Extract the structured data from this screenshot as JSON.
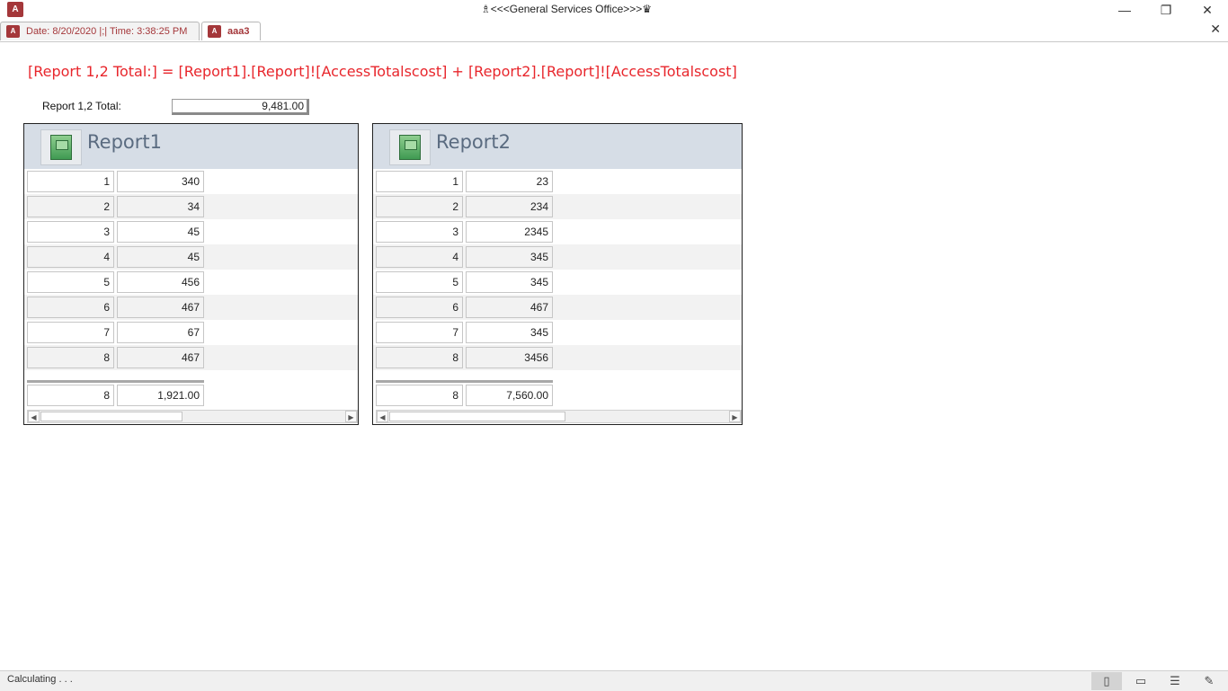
{
  "window": {
    "title": "♗<<<General Services Office>>>♛",
    "app_icon": "A",
    "minimize": "—",
    "restore": "❐",
    "close": "✕"
  },
  "tabs": [
    {
      "label": "Date: 8/20/2020 |;| Time: 3:38:25 PM",
      "icon": "access-icon",
      "active": false
    },
    {
      "label": "aaa3",
      "icon": "access-icon",
      "active": true
    }
  ],
  "tab_close": "✕",
  "form": {
    "formula": "[Report 1,2 Total:] = [Report1].[Report]![AccessTotalscost] + [Report2].[Report]![AccessTotalscost]",
    "total_label": "Report 1,2 Total:",
    "total_value": "9,481.00"
  },
  "report1": {
    "title": "Report1",
    "rows": [
      [
        "1",
        "340"
      ],
      [
        "2",
        "34"
      ],
      [
        "3",
        "45"
      ],
      [
        "4",
        "45"
      ],
      [
        "5",
        "456"
      ],
      [
        "6",
        "467"
      ],
      [
        "7",
        "67"
      ],
      [
        "8",
        "467"
      ]
    ],
    "footer": [
      "8",
      "1,921.00"
    ]
  },
  "report2": {
    "title": "Report2",
    "rows": [
      [
        "1",
        "23"
      ],
      [
        "2",
        "234"
      ],
      [
        "3",
        "2345"
      ],
      [
        "4",
        "345"
      ],
      [
        "5",
        "345"
      ],
      [
        "6",
        "467"
      ],
      [
        "7",
        "345"
      ],
      [
        "8",
        "3456"
      ]
    ],
    "footer": [
      "8",
      "7,560.00"
    ]
  },
  "statusbar": {
    "text": "Calculating . . .",
    "views": [
      "form-view-icon",
      "layout-view-icon",
      "datasheet-view-icon",
      "design-view-icon"
    ]
  }
}
